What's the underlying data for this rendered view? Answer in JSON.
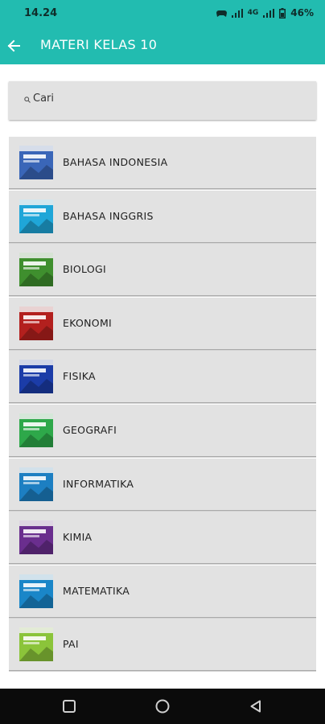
{
  "status_bar": {
    "time": "14.24",
    "network": "4G",
    "battery": "46%"
  },
  "app_bar": {
    "title": "MATERI KELAS 10"
  },
  "search": {
    "placeholder": "Cari"
  },
  "subjects": [
    {
      "label": "BAHASA INDONESIA",
      "cover_color": "#3a66b8"
    },
    {
      "label": "BAHASA INGGRIS",
      "cover_color": "#1fa6d8"
    },
    {
      "label": "BIOLOGI",
      "cover_color": "#3f8f2e"
    },
    {
      "label": "EKONOMI",
      "cover_color": "#b3201e"
    },
    {
      "label": "FISIKA",
      "cover_color": "#1b3ca8"
    },
    {
      "label": "GEOGRAFI",
      "cover_color": "#2ea84a"
    },
    {
      "label": "INFORMATIKA",
      "cover_color": "#1d7fc2"
    },
    {
      "label": "KIMIA",
      "cover_color": "#6a2e8e"
    },
    {
      "label": "MATEMATIKA",
      "cover_color": "#1a86c8"
    },
    {
      "label": "PAI",
      "cover_color": "#8bc43a"
    }
  ],
  "colors": {
    "primary": "#22bcb0",
    "item_background": "#e2e2e2"
  }
}
